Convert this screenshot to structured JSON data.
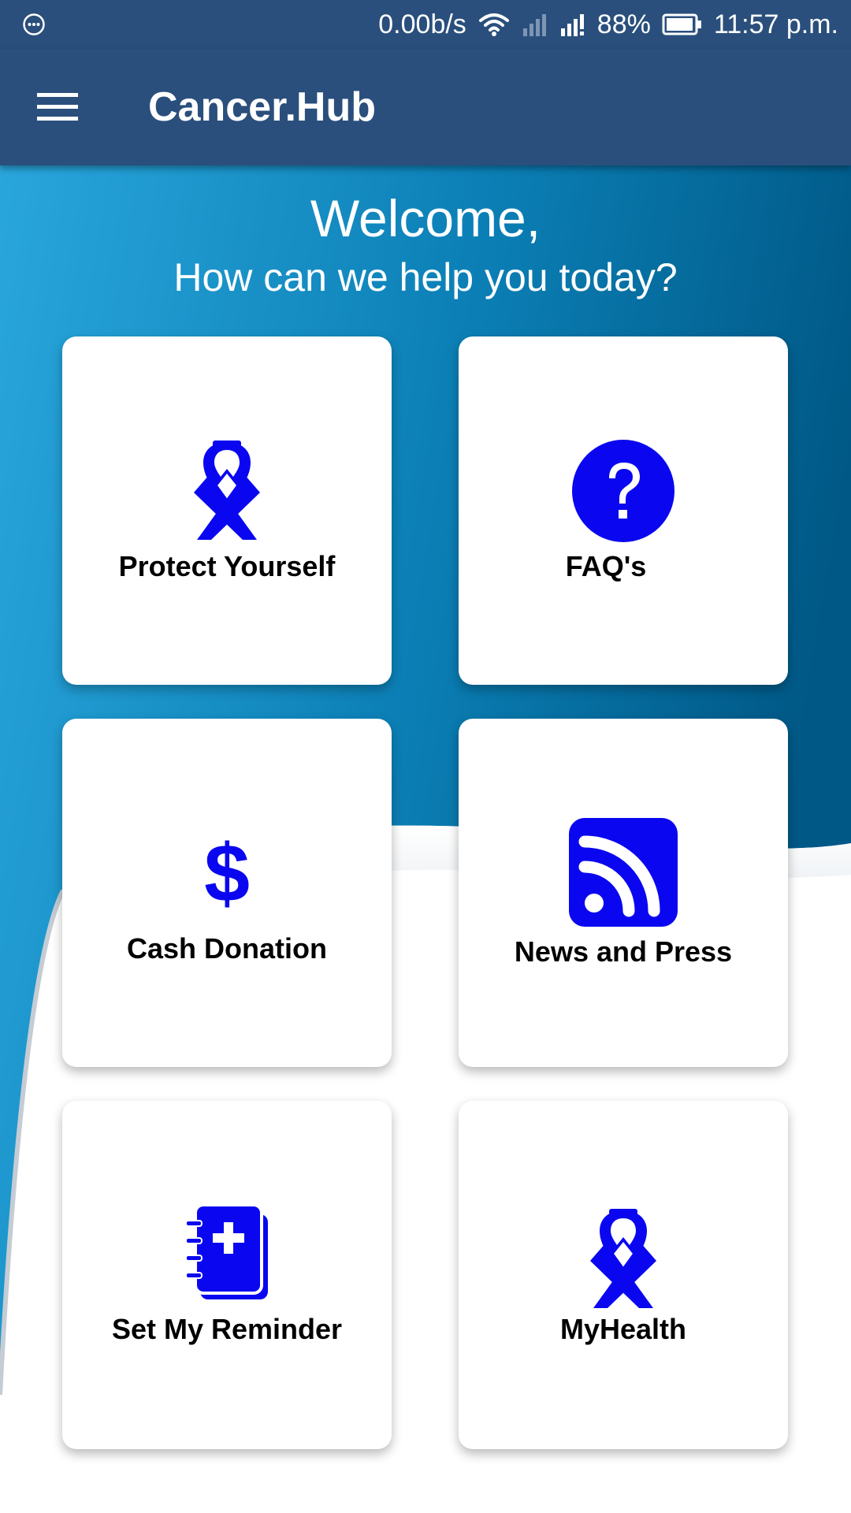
{
  "status_bar": {
    "network_speed": "0.00b/s",
    "battery": "88%",
    "time": "11:57 p.m."
  },
  "app_bar": {
    "title": "Cancer.Hub"
  },
  "hero": {
    "greeting": "Welcome,",
    "subtitle": "How can we help you today?"
  },
  "tiles": [
    {
      "label": "Protect Yourself",
      "icon": "awareness-ribbon-icon"
    },
    {
      "label": "FAQ's",
      "icon": "question-circle-icon"
    },
    {
      "label": "Cash Donation",
      "icon": "dollar-sign-icon"
    },
    {
      "label": "News and Press",
      "icon": "rss-feed-icon"
    },
    {
      "label": "Set My Reminder",
      "icon": "medical-notebook-icon"
    },
    {
      "label": "MyHealth",
      "icon": "awareness-ribbon-icon"
    }
  ],
  "colors": {
    "app_bar": "#2a4f7c",
    "icon_blue": "#0a07f0",
    "background_light": "#29a6dc",
    "background_dark": "#005e8e"
  }
}
